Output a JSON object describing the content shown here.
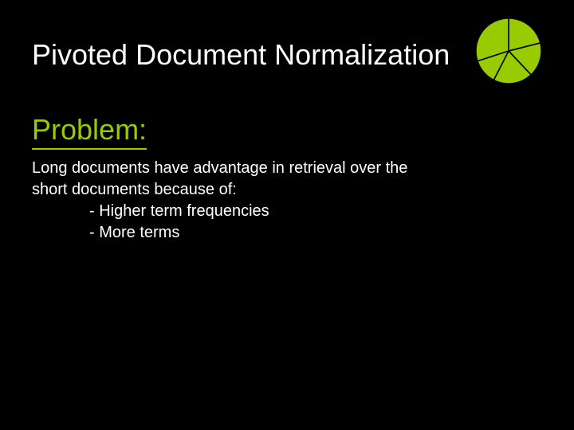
{
  "title": "Pivoted Document Normalization",
  "section_heading": "Problem:",
  "body_line1": "Long documents have advantage in retrieval over the",
  "body_line2": "short documents because of:",
  "bullet1": "- Higher term frequencies",
  "bullet2": "- More terms",
  "icon": {
    "name": "pie-icon",
    "color": "#99cc00"
  }
}
